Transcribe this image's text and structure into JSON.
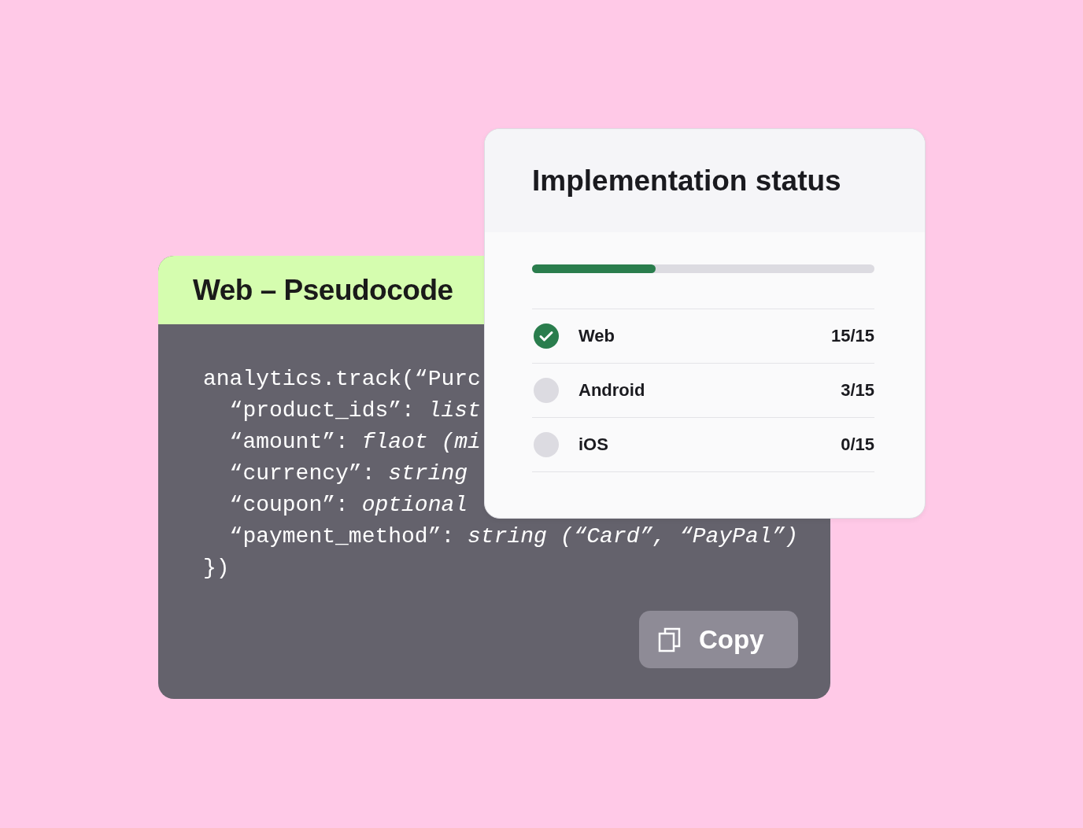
{
  "code_card": {
    "title": "Web – Pseudocode",
    "lines": [
      {
        "code": "analytics.track(“Purc"
      },
      {
        "code": "  “product_ids”: ",
        "type": "list"
      },
      {
        "code": "  “amount”: ",
        "type": "flaot (mi"
      },
      {
        "code": "  “currency”: ",
        "type": "string"
      },
      {
        "code": "  “coupon”: ",
        "type": "optional"
      },
      {
        "code": "  “payment_method”: ",
        "type": "string (“Card”, “PayPal”)"
      },
      {
        "code": "})"
      }
    ],
    "copy_button": "Copy"
  },
  "status_card": {
    "title": "Implementation status",
    "level": 0.36,
    "platforms": [
      {
        "name": "Web",
        "count": "15/15",
        "complete": true
      },
      {
        "name": "Android",
        "count": "3/15",
        "complete": false
      },
      {
        "name": "iOS",
        "count": "0/15",
        "complete": false
      }
    ]
  }
}
